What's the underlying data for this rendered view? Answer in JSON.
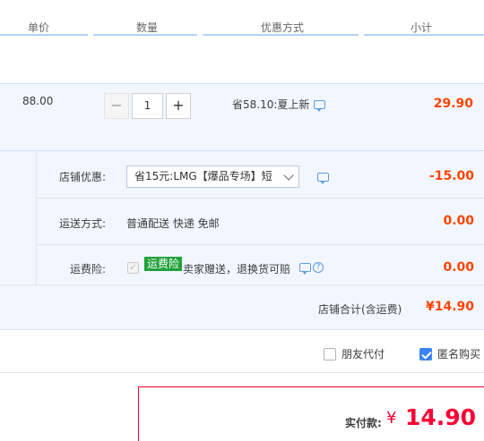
{
  "header": {
    "col_price": "单价",
    "col_qty": "数量",
    "col_promo": "优惠方式",
    "col_subtotal": "小计"
  },
  "item": {
    "price": "88.00",
    "qty_minus": "−",
    "qty_value": "1",
    "qty_plus": "+",
    "promo": "省58.10:夏上新",
    "subtotal": "29.90"
  },
  "shop": {
    "discount_label": "店铺优惠:",
    "discount_select": "省15元:LMG【爆品专场】短",
    "discount_amount": "-15.00",
    "shipping_label": "运送方式:",
    "shipping_value": "普通配送 快递 免邮",
    "shipping_amount": "0.00",
    "insurance_label": "运费险:",
    "insurance_check": "✓",
    "insurance_tag": "运费险",
    "insurance_text": "卖家赠送，退换货可赔",
    "insurance_help": "?",
    "insurance_amount": "0.00",
    "total_label": "店铺合计(含运费)",
    "total_amount": "¥14.90"
  },
  "options": {
    "friend_pay": "朋友代付",
    "anonymous": "匿名购买"
  },
  "payment": {
    "label": "实付款:",
    "currency": "¥",
    "amount": "14.90"
  },
  "colors": {
    "accent_red": "#ff0036",
    "price_orange": "#ff4400",
    "row_bg": "#f2f7ff",
    "checkbox_blue": "#3b82f6",
    "tag_green": "#21a13a"
  },
  "icons": [
    "chat-icon",
    "chevron-down-icon",
    "help-icon",
    "check-icon"
  ]
}
